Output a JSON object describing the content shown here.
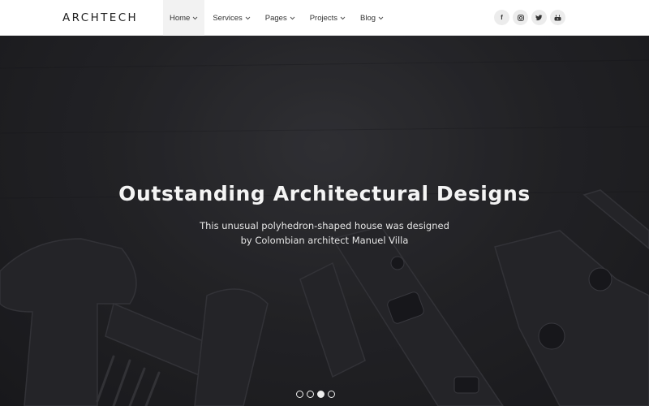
{
  "brand": {
    "logo": "ARCHTECH"
  },
  "nav": {
    "items": [
      {
        "label": "Home",
        "active": true
      },
      {
        "label": "Services",
        "active": false
      },
      {
        "label": "Pages",
        "active": false
      },
      {
        "label": "Projects",
        "active": false
      },
      {
        "label": "Blog",
        "active": false
      }
    ]
  },
  "social": [
    {
      "icon": "facebook-icon",
      "glyph": "f"
    },
    {
      "icon": "instagram-icon",
      "glyph": ""
    },
    {
      "icon": "twitter-icon",
      "glyph": ""
    },
    {
      "icon": "youtube-icon",
      "glyph": ""
    }
  ],
  "hero": {
    "title": "Outstanding Architectural Designs",
    "subtitle_line1": "This unusual polyhedron-shaped house was designed",
    "subtitle_line2": "by Colombian architect Manuel Villa"
  },
  "slider": {
    "count": 4,
    "active_index": 2
  }
}
